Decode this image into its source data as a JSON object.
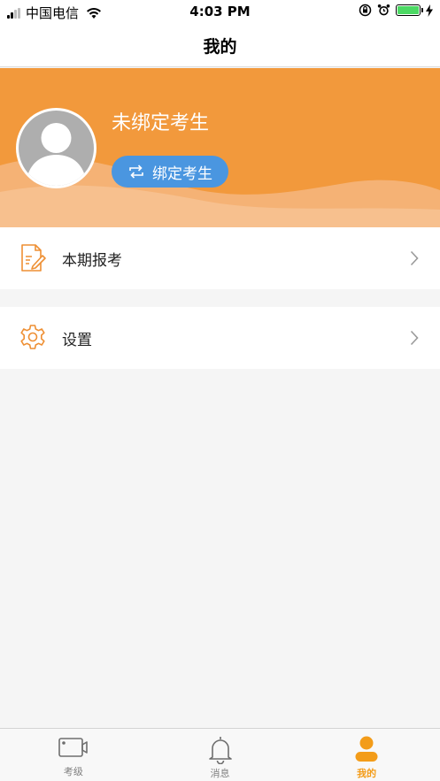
{
  "status_bar": {
    "carrier": "中国电信",
    "time": "4:03 PM"
  },
  "nav": {
    "title": "我的"
  },
  "profile": {
    "name": "未绑定考生",
    "bind_button_label": "绑定考生"
  },
  "menu": {
    "items": [
      {
        "label": "本期报考",
        "icon": "document-edit-icon"
      },
      {
        "label": "设置",
        "icon": "gear-icon"
      }
    ]
  },
  "tabbar": {
    "tabs": [
      {
        "label": "考级",
        "icon": "video-camera-icon",
        "active": false
      },
      {
        "label": "消息",
        "icon": "bell-icon",
        "active": false
      },
      {
        "label": "我的",
        "icon": "person-icon",
        "active": true
      }
    ]
  },
  "colors": {
    "accent": "#f39c19",
    "banner": "#f2993c",
    "bind_button": "#4a96e0",
    "battery": "#4cd964"
  }
}
